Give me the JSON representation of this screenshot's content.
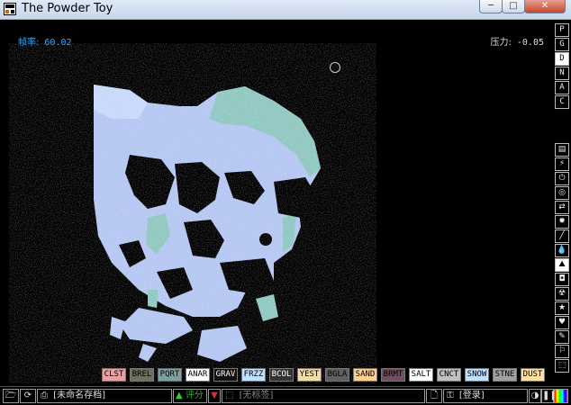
{
  "window": {
    "title": "The Powder Toy",
    "min_label": "─",
    "max_label": "□",
    "close_label": "✕"
  },
  "hud": {
    "fps_label": "帧率:",
    "fps_value": "60.02",
    "pressure_label": "压力:",
    "pressure_value": "-0.05"
  },
  "side_menu": {
    "top_buttons": [
      "P",
      "G",
      "D",
      "N",
      "A",
      "C"
    ],
    "selected_top": "D",
    "categories": [
      {
        "icon": "wall-icon",
        "glyph": "▤"
      },
      {
        "icon": "electronics-icon",
        "glyph": "⚡"
      },
      {
        "icon": "power-icon",
        "glyph": "⏻"
      },
      {
        "icon": "sensor-icon",
        "glyph": "◎"
      },
      {
        "icon": "force-icon",
        "glyph": "⇄"
      },
      {
        "icon": "explosives-icon",
        "glyph": "✹"
      },
      {
        "icon": "gases-icon",
        "glyph": "╱"
      },
      {
        "icon": "liquids-icon",
        "glyph": "💧"
      },
      {
        "icon": "powders-icon",
        "glyph": "⛰"
      },
      {
        "icon": "solids-icon",
        "glyph": "◘"
      },
      {
        "icon": "radioactive-icon",
        "glyph": "☢"
      },
      {
        "icon": "special-icon",
        "glyph": "★"
      },
      {
        "icon": "life-icon",
        "glyph": "♥"
      },
      {
        "icon": "tools-icon",
        "glyph": "✎"
      },
      {
        "icon": "favorites-icon",
        "glyph": "⚐"
      },
      {
        "icon": "decoration-icon",
        "glyph": "⬚"
      }
    ],
    "selected_category": "powders-icon"
  },
  "element_bar": {
    "items": [
      {
        "label": "CLST",
        "bg": "#e8a0a0",
        "fg": "#000"
      },
      {
        "label": "BREL",
        "bg": "#707060",
        "fg": "#000"
      },
      {
        "label": "PQRT",
        "bg": "#80a0a0",
        "fg": "#000"
      },
      {
        "label": "ANAR",
        "bg": "#ffffff",
        "fg": "#000"
      },
      {
        "label": "GRAV",
        "bg": "#101010",
        "fg": "#fff"
      },
      {
        "label": "FRZZ",
        "bg": "#c0e0ff",
        "fg": "#000"
      },
      {
        "label": "BCOL",
        "bg": "#333333",
        "fg": "#fff"
      },
      {
        "label": "YEST",
        "bg": "#eeddaa",
        "fg": "#000"
      },
      {
        "label": "BGLA",
        "bg": "#606060",
        "fg": "#000"
      },
      {
        "label": "SAND",
        "bg": "#ffd090",
        "fg": "#000"
      },
      {
        "label": "BRMT",
        "bg": "#705060",
        "fg": "#000"
      },
      {
        "label": "SALT",
        "bg": "#ffffff",
        "fg": "#000"
      },
      {
        "label": "CNCT",
        "bg": "#c0c0c0",
        "fg": "#000"
      },
      {
        "label": "SNOW",
        "bg": "#c0e0ff",
        "fg": "#000"
      },
      {
        "label": "STNE",
        "bg": "#a0a0a0",
        "fg": "#000"
      },
      {
        "label": "DUST",
        "bg": "#ffe0a0",
        "fg": "#000"
      }
    ],
    "selected": "PQRT"
  },
  "bottom": {
    "save_name": "[未命名存档]",
    "vote_label": "评分",
    "tags": "[无标签]",
    "login": "[登录]"
  }
}
